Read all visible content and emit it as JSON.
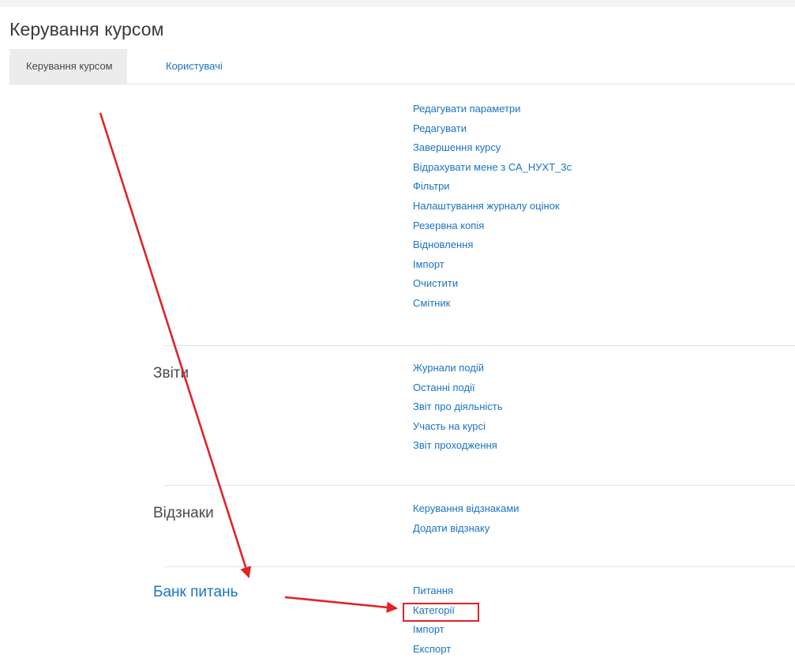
{
  "page": {
    "title": "Керування курсом"
  },
  "tabs": [
    {
      "label": "Керування курсом",
      "active": true
    },
    {
      "label": "Користувачі",
      "active": false
    }
  ],
  "sections": [
    {
      "id": "course",
      "label": "",
      "links": [
        "Редагувати параметри",
        "Редагувати",
        "Завершення курсу",
        "Відрахувати мене з СА_НУХТ_3с",
        "Фільтри",
        "Налаштування журналу оцінок",
        "Резервна копія",
        "Відновлення",
        "Імпорт",
        "Очистити",
        "Смітник"
      ]
    },
    {
      "id": "reports",
      "label": "Звіти",
      "links": [
        "Журнали подій",
        "Останні події",
        "Звіт про діяльність",
        "Участь на курсі",
        "Звіт проходження"
      ]
    },
    {
      "id": "badges",
      "label": "Відзнаки",
      "links": [
        "Керування відзнаками",
        "Додати відзнаку"
      ]
    },
    {
      "id": "question-bank",
      "label": "Банк питань",
      "label_is_link": true,
      "links": [
        "Питання",
        "Категорії",
        "Імпорт",
        "Експорт"
      ]
    }
  ],
  "colors": {
    "link": "#1a73c6",
    "annotation": "#e12326",
    "active_tab_bg": "#ececec"
  },
  "annotations": {
    "highlighted_link": "Категорії"
  }
}
